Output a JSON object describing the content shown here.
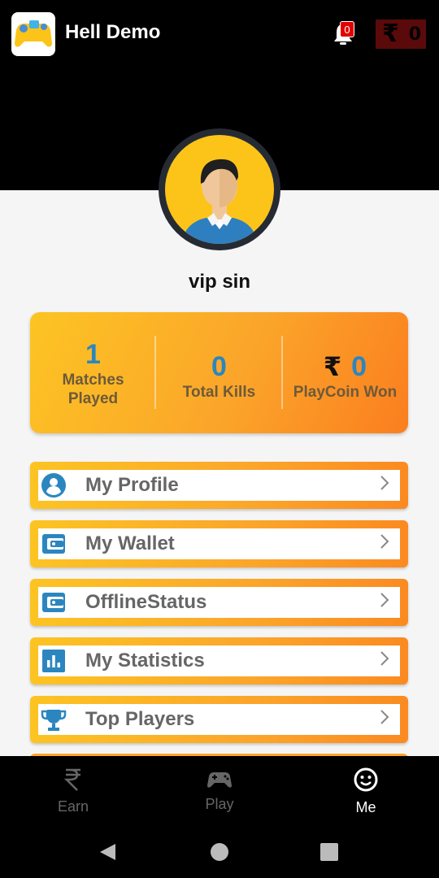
{
  "app": {
    "title": "Hell Demo"
  },
  "header": {
    "notification_count": "0",
    "wallet_symbol": "₹",
    "wallet_amount": "0"
  },
  "profile": {
    "username": "vip sin"
  },
  "stats": [
    {
      "value": "1",
      "label": "Matches Played"
    },
    {
      "value": "0",
      "label": "Total Kills"
    },
    {
      "symbol": "₹",
      "value": "0",
      "label": "PlayCoin Won"
    }
  ],
  "menu": [
    {
      "label": "My Profile",
      "icon": "user-circle-icon"
    },
    {
      "label": "My Wallet",
      "icon": "wallet-icon"
    },
    {
      "label": "OfflineStatus",
      "icon": "wallet-icon"
    },
    {
      "label": "My Statistics",
      "icon": "bar-chart-icon"
    },
    {
      "label": "Top Players",
      "icon": "trophy-icon"
    }
  ],
  "bottom_nav": [
    {
      "label": "Earn",
      "icon": "rupee-icon",
      "active": false
    },
    {
      "label": "Play",
      "icon": "gamepad-icon",
      "active": false
    },
    {
      "label": "Me",
      "icon": "smiley-icon",
      "active": true
    }
  ],
  "colors": {
    "accent_blue": "#2b86c0",
    "card_orange_start": "#fcc423",
    "card_orange_end": "#fb7e1f",
    "header_bg": "#000000"
  }
}
